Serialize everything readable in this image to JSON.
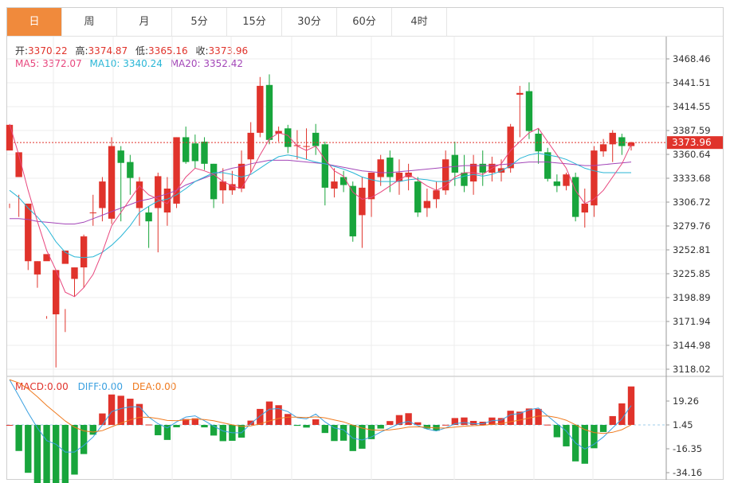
{
  "tabs": [
    {
      "label": "日",
      "active": true
    },
    {
      "label": "周",
      "active": false
    },
    {
      "label": "月",
      "active": false
    },
    {
      "label": "5分",
      "active": false
    },
    {
      "label": "15分",
      "active": false
    },
    {
      "label": "30分",
      "active": false
    },
    {
      "label": "60分",
      "active": false
    },
    {
      "label": "4时",
      "active": false
    }
  ],
  "ohlc": {
    "open_label": "开:",
    "open": "3370.22",
    "high_label": "高:",
    "high": "3374.87",
    "low_label": "低:",
    "low": "3365.16",
    "close_label": "收:",
    "close": "3373.96"
  },
  "ma": {
    "ma5_label": "MA5:",
    "ma5": "3372.07",
    "ma10_label": "MA10:",
    "ma10": "3340.24",
    "ma20_label": "MA20:",
    "ma20": "3352.42"
  },
  "macd": {
    "macd_label": "MACD:",
    "macd": "0.00",
    "diff_label": "DIFF:",
    "diff": "0.00",
    "dea_label": "DEA:",
    "dea": "0.00"
  },
  "colors": {
    "up": "#e0332b",
    "down": "#18a53c",
    "ma5": "#e8477e",
    "ma10": "#29b6d6",
    "ma20": "#a346b8",
    "diff": "#3aa0e0",
    "dea": "#ef7a1e",
    "active_tab": "#f08a3c"
  },
  "chart_data": {
    "type": "candlestick",
    "price_ticks": [
      "3468.46",
      "3441.51",
      "3414.55",
      "3387.59",
      "3360.64",
      "3333.68",
      "3306.72",
      "3279.76",
      "3252.81",
      "3225.85",
      "3198.89",
      "3171.94",
      "3144.98",
      "3118.02"
    ],
    "price_range": [
      3118.02,
      3468.46
    ],
    "current_price": "3373.96",
    "macd_ticks": [
      "19.26",
      "1.45",
      "-16.35",
      "-34.16"
    ],
    "macd_range": [
      -34.16,
      19.26
    ],
    "candles": [
      [
        3365,
        3394,
        3305,
        3300
      ],
      [
        3335,
        3363,
        3315,
        3290
      ],
      [
        3240,
        3305,
        3305,
        3230
      ],
      [
        3225,
        3240,
        3240,
        3210
      ],
      [
        3240,
        3248,
        3178,
        3175
      ],
      [
        3180,
        3230,
        3230,
        3120
      ],
      [
        3237,
        3252,
        3186,
        3160
      ],
      [
        3220,
        3233,
        3233,
        3200
      ],
      [
        3233,
        3268,
        3270,
        3210
      ],
      [
        3295,
        3295,
        3315,
        3280
      ],
      [
        3300,
        3330,
        3335,
        3285
      ],
      [
        3288,
        3370,
        3380,
        3282
      ],
      [
        3365,
        3351,
        3370,
        3285
      ],
      [
        3352,
        3334,
        3360,
        3315
      ],
      [
        3300,
        3330,
        3335,
        3280
      ],
      [
        3295,
        3285,
        3302,
        3255
      ],
      [
        3300,
        3336,
        3340,
        3250
      ],
      [
        3295,
        3322,
        3335,
        3280
      ],
      [
        3305,
        3380,
        3380,
        3300
      ],
      [
        3380,
        3352,
        3392,
        3350
      ],
      [
        3373,
        3353,
        3383,
        3345
      ],
      [
        3375,
        3350,
        3380,
        3343
      ],
      [
        3350,
        3310,
        3350,
        3300
      ],
      [
        3320,
        3330,
        3345,
        3305
      ],
      [
        3320,
        3327,
        3342,
        3315
      ],
      [
        3322,
        3350,
        3365,
        3318
      ],
      [
        3355,
        3385,
        3397,
        3340
      ],
      [
        3385,
        3438,
        3448,
        3380
      ],
      [
        3439,
        3377,
        3451,
        3372
      ],
      [
        3384,
        3387,
        3392,
        3375
      ],
      [
        3390,
        3369,
        3394,
        3362
      ],
      [
        3370,
        3371,
        3388,
        3355
      ],
      [
        3370,
        3370,
        3390,
        3355
      ],
      [
        3385,
        3370,
        3395,
        3360
      ],
      [
        3372,
        3323,
        3375,
        3303
      ],
      [
        3322,
        3330,
        3345,
        3312
      ],
      [
        3335,
        3326,
        3342,
        3318
      ],
      [
        3325,
        3268,
        3330,
        3262
      ],
      [
        3292,
        3323,
        3335,
        3255
      ],
      [
        3310,
        3340,
        3340,
        3290
      ],
      [
        3335,
        3355,
        3360,
        3325
      ],
      [
        3357,
        3335,
        3365,
        3318
      ],
      [
        3330,
        3340,
        3355,
        3315
      ],
      [
        3335,
        3340,
        3350,
        3320
      ],
      [
        3330,
        3295,
        3335,
        3290
      ],
      [
        3300,
        3308,
        3322,
        3290
      ],
      [
        3310,
        3320,
        3330,
        3300
      ],
      [
        3320,
        3355,
        3365,
        3315
      ],
      [
        3360,
        3340,
        3375,
        3325
      ],
      [
        3340,
        3325,
        3360,
        3318
      ],
      [
        3330,
        3350,
        3360,
        3315
      ],
      [
        3350,
        3340,
        3365,
        3325
      ],
      [
        3340,
        3350,
        3358,
        3330
      ],
      [
        3340,
        3345,
        3355,
        3330
      ],
      [
        3345,
        3392,
        3395,
        3340
      ],
      [
        3428,
        3430,
        3438,
        3380
      ],
      [
        3432,
        3387,
        3442,
        3378
      ],
      [
        3384,
        3364,
        3390,
        3350
      ],
      [
        3363,
        3333,
        3368,
        3330
      ],
      [
        3330,
        3325,
        3338,
        3318
      ],
      [
        3325,
        3338,
        3340,
        3320
      ],
      [
        3335,
        3290,
        3340,
        3285
      ],
      [
        3295,
        3305,
        3322,
        3278
      ],
      [
        3303,
        3365,
        3370,
        3290
      ],
      [
        3364,
        3372,
        3378,
        3358
      ],
      [
        3372,
        3385,
        3388,
        3352
      ],
      [
        3380,
        3370,
        3384,
        3360
      ],
      [
        3370,
        3374,
        3375,
        3365
      ]
    ],
    "ma5": [
      3395,
      3360,
      3320,
      3285,
      3252,
      3230,
      3205,
      3200,
      3210,
      3225,
      3250,
      3280,
      3295,
      3310,
      3325,
      3315,
      3310,
      3305,
      3320,
      3335,
      3345,
      3342,
      3338,
      3330,
      3325,
      3322,
      3340,
      3360,
      3378,
      3385,
      3382,
      3370,
      3365,
      3370,
      3355,
      3342,
      3336,
      3318,
      3310,
      3312,
      3318,
      3325,
      3332,
      3338,
      3332,
      3325,
      3320,
      3325,
      3335,
      3340,
      3340,
      3338,
      3345,
      3350,
      3365,
      3375,
      3385,
      3390,
      3375,
      3360,
      3345,
      3320,
      3305,
      3310,
      3320,
      3335,
      3350,
      3372
    ],
    "ma10": [
      3320,
      3312,
      3300,
      3290,
      3278,
      3262,
      3250,
      3245,
      3244,
      3245,
      3250,
      3258,
      3268,
      3280,
      3295,
      3302,
      3308,
      3310,
      3315,
      3322,
      3330,
      3335,
      3340,
      3340,
      3338,
      3335,
      3338,
      3345,
      3352,
      3358,
      3360,
      3358,
      3355,
      3352,
      3350,
      3347,
      3344,
      3340,
      3335,
      3332,
      3330,
      3330,
      3330,
      3332,
      3333,
      3332,
      3330,
      3330,
      3333,
      3336,
      3338,
      3336,
      3338,
      3342,
      3348,
      3356,
      3360,
      3362,
      3360,
      3358,
      3355,
      3350,
      3345,
      3342,
      3340,
      3340,
      3340,
      3340
    ],
    "ma20": [
      3288,
      3288,
      3287,
      3285,
      3284,
      3283,
      3282,
      3282,
      3284,
      3288,
      3292,
      3296,
      3300,
      3304,
      3308,
      3310,
      3313,
      3316,
      3320,
      3326,
      3330,
      3334,
      3338,
      3342,
      3345,
      3347,
      3350,
      3352,
      3354,
      3354,
      3354,
      3353,
      3352,
      3351,
      3350,
      3348,
      3346,
      3344,
      3342,
      3341,
      3340,
      3340,
      3341,
      3342,
      3343,
      3344,
      3345,
      3346,
      3347,
      3348,
      3348,
      3348,
      3348,
      3349,
      3350,
      3351,
      3352,
      3352,
      3352,
      3351,
      3350,
      3349,
      3348,
      3348,
      3349,
      3350,
      3351,
      3352
    ]
  }
}
